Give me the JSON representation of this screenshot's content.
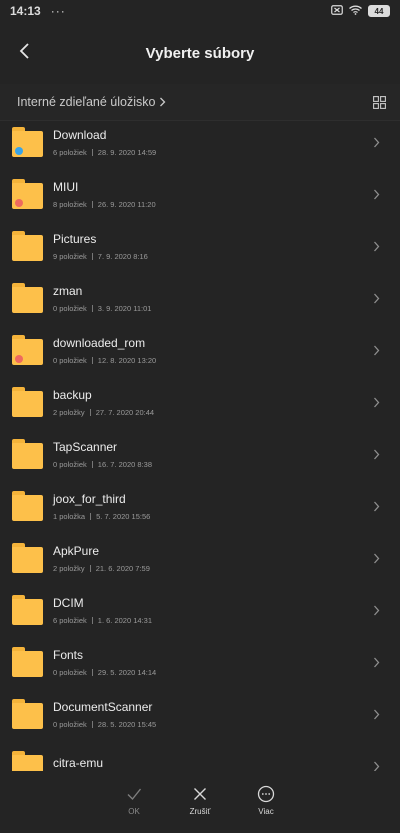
{
  "status_bar": {
    "time": "14:13",
    "dots": "···",
    "battery": "44"
  },
  "header": {
    "title": "Vyberte súbory"
  },
  "path": {
    "location": "Interné zdieľané úložisko"
  },
  "files": [
    {
      "name": "Download",
      "count": "6 položiek",
      "date": "28. 9. 2020 14:59",
      "badge": "blue"
    },
    {
      "name": "MIUI",
      "count": "8 položiek",
      "date": "26. 9. 2020 11:20",
      "badge": "red"
    },
    {
      "name": "Pictures",
      "count": "9 položiek",
      "date": "7. 9. 2020 8:16",
      "badge": ""
    },
    {
      "name": "zman",
      "count": "0 položiek",
      "date": "3. 9. 2020 11:01",
      "badge": ""
    },
    {
      "name": "downloaded_rom",
      "count": "0 položiek",
      "date": "12. 8. 2020 13:20",
      "badge": "red"
    },
    {
      "name": "backup",
      "count": "2 položky",
      "date": "27. 7. 2020 20:44",
      "badge": ""
    },
    {
      "name": "TapScanner",
      "count": "0 položiek",
      "date": "16. 7. 2020 8:38",
      "badge": ""
    },
    {
      "name": "joox_for_third",
      "count": "1 položka",
      "date": "5. 7. 2020 15:56",
      "badge": ""
    },
    {
      "name": "ApkPure",
      "count": "2 položky",
      "date": "21. 6. 2020 7:59",
      "badge": ""
    },
    {
      "name": "DCIM",
      "count": "6 položiek",
      "date": "1. 6. 2020 14:31",
      "badge": ""
    },
    {
      "name": "Fonts",
      "count": "0 položiek",
      "date": "29. 5. 2020 14:14",
      "badge": ""
    },
    {
      "name": "DocumentScanner",
      "count": "0 položiek",
      "date": "28. 5. 2020 15:45",
      "badge": ""
    },
    {
      "name": "citra-emu",
      "count": "",
      "date": "",
      "badge": ""
    }
  ],
  "bottom_bar": {
    "ok": "OK",
    "cancel": "Zrušiť",
    "more": "Viac"
  },
  "colors": {
    "background": "#242424",
    "folder": "#fdc04a",
    "badge_blue": "#3aa4e8",
    "badge_red": "#ef6a5e"
  },
  "icons": [
    "wifi-icon",
    "battery-icon",
    "sim-icon",
    "back-arrow-icon",
    "chevron-right-icon",
    "grid-view-icon",
    "folder-icon",
    "check-icon",
    "close-icon",
    "more-icon"
  ]
}
